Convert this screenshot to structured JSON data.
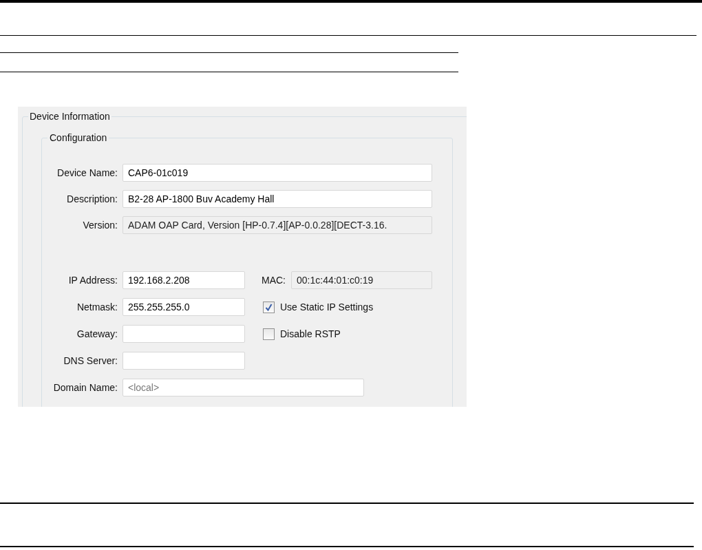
{
  "panel": {
    "title": "Device Information"
  },
  "configuration": {
    "title": "Configuration",
    "fields": [
      {
        "label": "Device Name:",
        "value": "CAP6-01c019",
        "kind": "text"
      },
      {
        "label": "Description:",
        "value": "B2-28 AP-1800 Buv Academy Hall",
        "kind": "text"
      },
      {
        "label": "Version:",
        "value": "ADAM OAP Card, Version [HP-0.7.4][AP-0.0.28][DECT-3.16.",
        "kind": "readonly"
      }
    ],
    "network_fields": [
      {
        "label": "IP Address:",
        "value": "192.168.2.208",
        "kind": "text"
      },
      {
        "label": "Netmask:",
        "value": "255.255.255.0",
        "kind": "text"
      },
      {
        "label": "Gateway:",
        "kind": "text"
      },
      {
        "label": "DNS Server:",
        "kind": "text"
      },
      {
        "label": "Domain Name:",
        "placeholder": "<local>",
        "kind": "text"
      }
    ],
    "mac": {
      "label": "MAC:",
      "value": "00:1c:44:01:c0:19",
      "kind": "readonly"
    },
    "options": [
      {
        "label": "Use Static IP Settings",
        "checked": true
      },
      {
        "label": "Disable RSTP",
        "checked": false
      }
    ]
  }
}
